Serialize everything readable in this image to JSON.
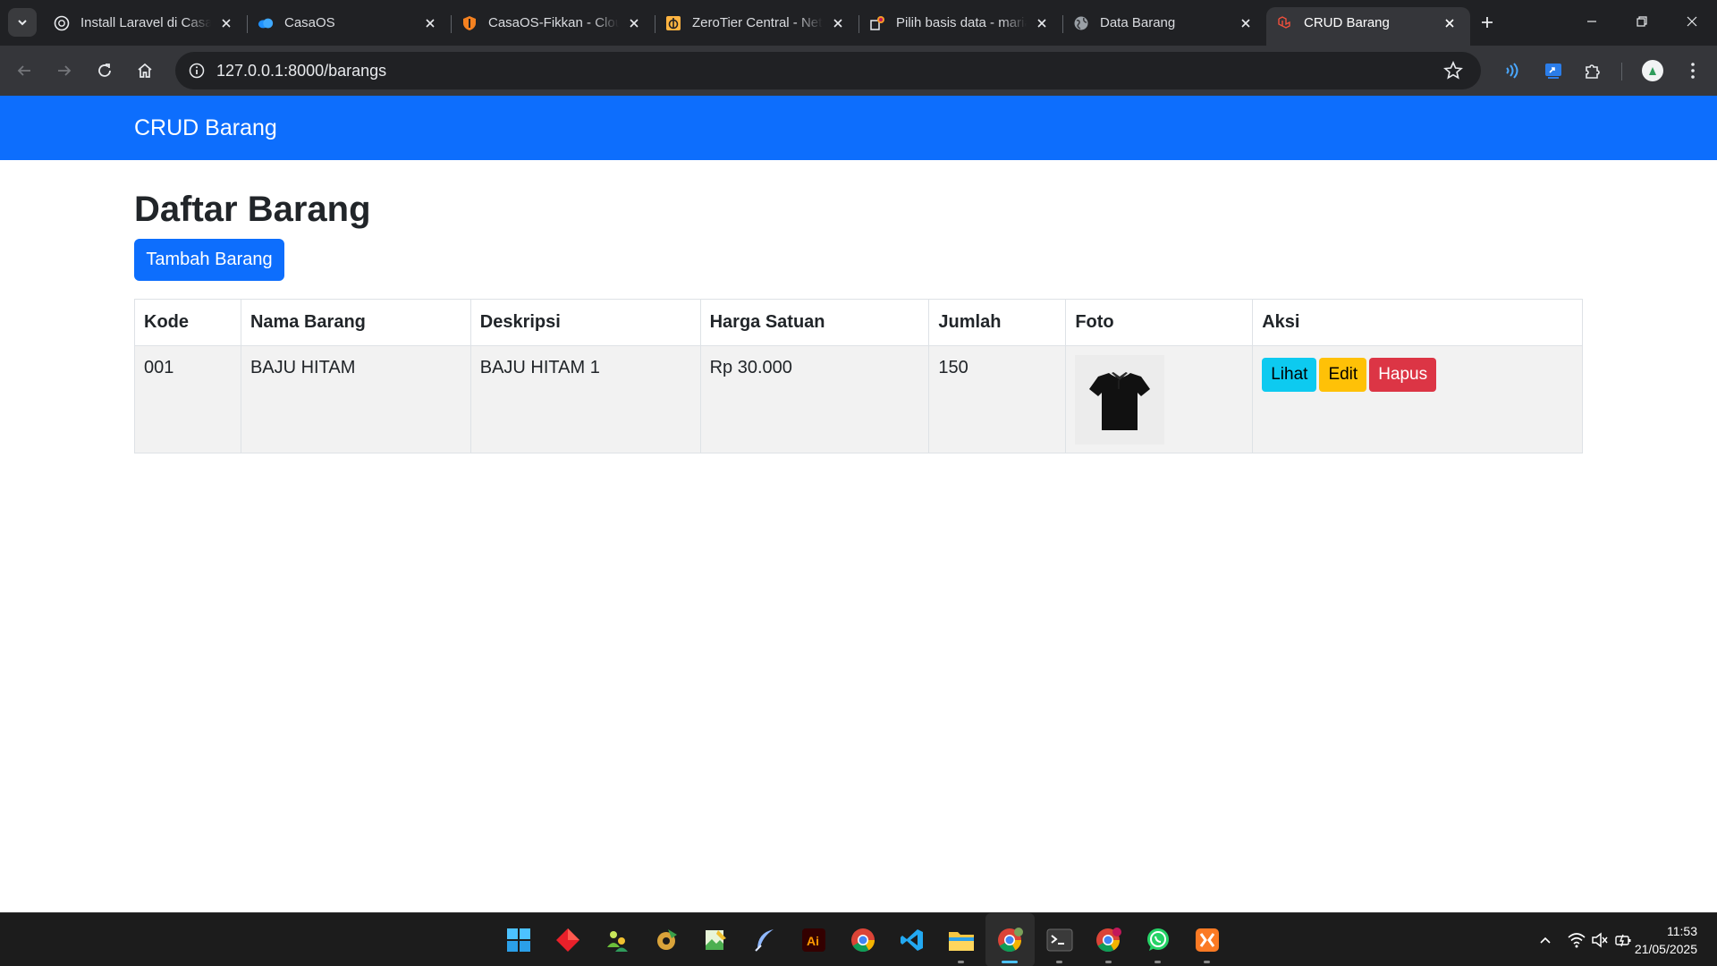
{
  "browser": {
    "tabs": [
      {
        "title": "Install Laravel di CasaOS",
        "icon": "openai-icon",
        "active": false
      },
      {
        "title": "CasaOS",
        "icon": "casaos-icon",
        "active": false
      },
      {
        "title": "CasaOS-Fikkan - Cloudflare",
        "icon": "shield-icon",
        "active": false
      },
      {
        "title": "ZeroTier Central - Networks",
        "icon": "zerotier-icon",
        "active": false
      },
      {
        "title": "Pilih basis data - mariadb",
        "icon": "phpmyadmin-icon",
        "active": false
      },
      {
        "title": "Data Barang",
        "icon": "globe-icon",
        "active": false
      },
      {
        "title": "CRUD Barang",
        "icon": "laravel-icon",
        "active": true
      }
    ],
    "url": "127.0.0.1:8000/barangs"
  },
  "page": {
    "brand": "CRUD Barang",
    "title": "Daftar Barang",
    "add_button": "Tambah Barang",
    "table": {
      "headers": [
        "Kode",
        "Nama Barang",
        "Deskripsi",
        "Harga Satuan",
        "Jumlah",
        "Foto",
        "Aksi"
      ],
      "rows": [
        {
          "kode": "001",
          "nama": "BAJU HITAM",
          "deskripsi": "BAJU HITAM 1",
          "harga": "Rp 30.000",
          "jumlah": "150",
          "foto": "black-tshirt-photo"
        }
      ],
      "actions": {
        "view": "Lihat",
        "edit": "Edit",
        "delete": "Hapus"
      }
    }
  },
  "colors": {
    "primary": "#0d6efd",
    "info": "#0dcaf0",
    "warning": "#ffc107",
    "danger": "#dc3545"
  },
  "taskbar": {
    "time": "11:53",
    "date": "21/05/2025"
  }
}
